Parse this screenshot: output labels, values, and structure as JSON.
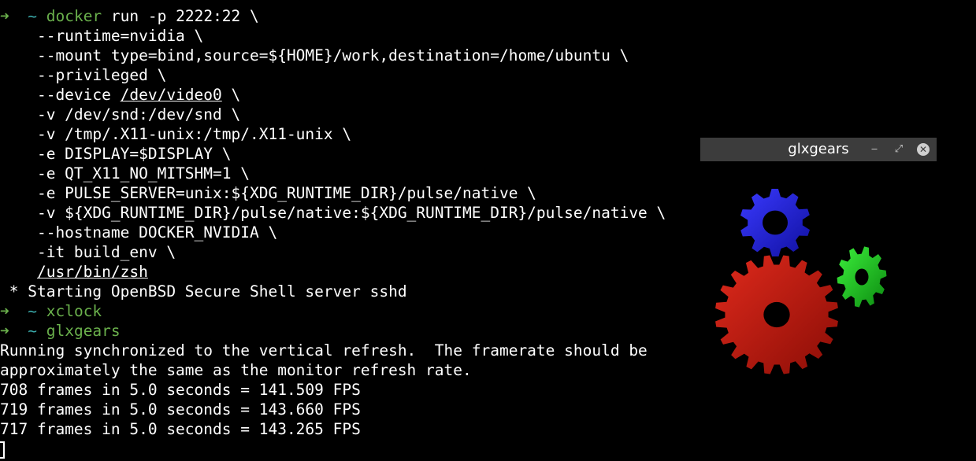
{
  "terminal": {
    "prompt_arrow": "➜",
    "prompt_dir": "~",
    "docker_cmd": "docker",
    "docker_args": " run -p 2222:22 \\",
    "lines": [
      "    --runtime=nvidia \\",
      "    --mount type=bind,source=${HOME}/work,destination=/home/ubuntu \\",
      "    --privileged \\"
    ],
    "device_prefix": "    --device ",
    "device_path": "/dev/video0",
    "device_suffix": " \\",
    "lines2": [
      "    -v /dev/snd:/dev/snd \\",
      "    -v /tmp/.X11-unix:/tmp/.X11-unix \\",
      "    -e DISPLAY=$DISPLAY \\",
      "    -e QT_X11_NO_MITSHM=1 \\",
      "    -e PULSE_SERVER=unix:${XDG_RUNTIME_DIR}/pulse/native \\",
      "    -v ${XDG_RUNTIME_DIR}/pulse/native:${XDG_RUNTIME_DIR}/pulse/native \\",
      "    --hostname DOCKER_NVIDIA \\",
      "    -it build_env \\"
    ],
    "shell_indent": "    ",
    "shell_path": "/usr/bin/zsh",
    "sshd_line": " * Starting OpenBSD Secure Shell server sshd",
    "cmd_xclock": "xclock",
    "cmd_glxgears": "glxgears",
    "output": [
      "Running synchronized to the vertical refresh.  The framerate should be",
      "approximately the same as the monitor refresh rate.",
      "708 frames in 5.0 seconds = 141.509 FPS",
      "719 frames in 5.0 seconds = 143.660 FPS",
      "717 frames in 5.0 seconds = 143.265 FPS"
    ]
  },
  "glxgears_window": {
    "title": "glxgears",
    "minimize_icon": "minimize-icon",
    "maximize_icon": "maximize-icon",
    "close_icon": "close-icon",
    "minimize_glyph": "‒",
    "maximize_glyph": "⤢",
    "close_glyph": "✕",
    "gears": [
      {
        "name": "blue-gear",
        "color": "#2020e0"
      },
      {
        "name": "red-gear",
        "color": "#cc1a10"
      },
      {
        "name": "green-gear",
        "color": "#1fcc22"
      }
    ]
  },
  "colors": {
    "background": "#000000",
    "text": "#ffffff",
    "prompt_green": "#6ab04c",
    "prompt_cyan": "#3aa9a9",
    "titlebar": "#3c3c3c"
  }
}
